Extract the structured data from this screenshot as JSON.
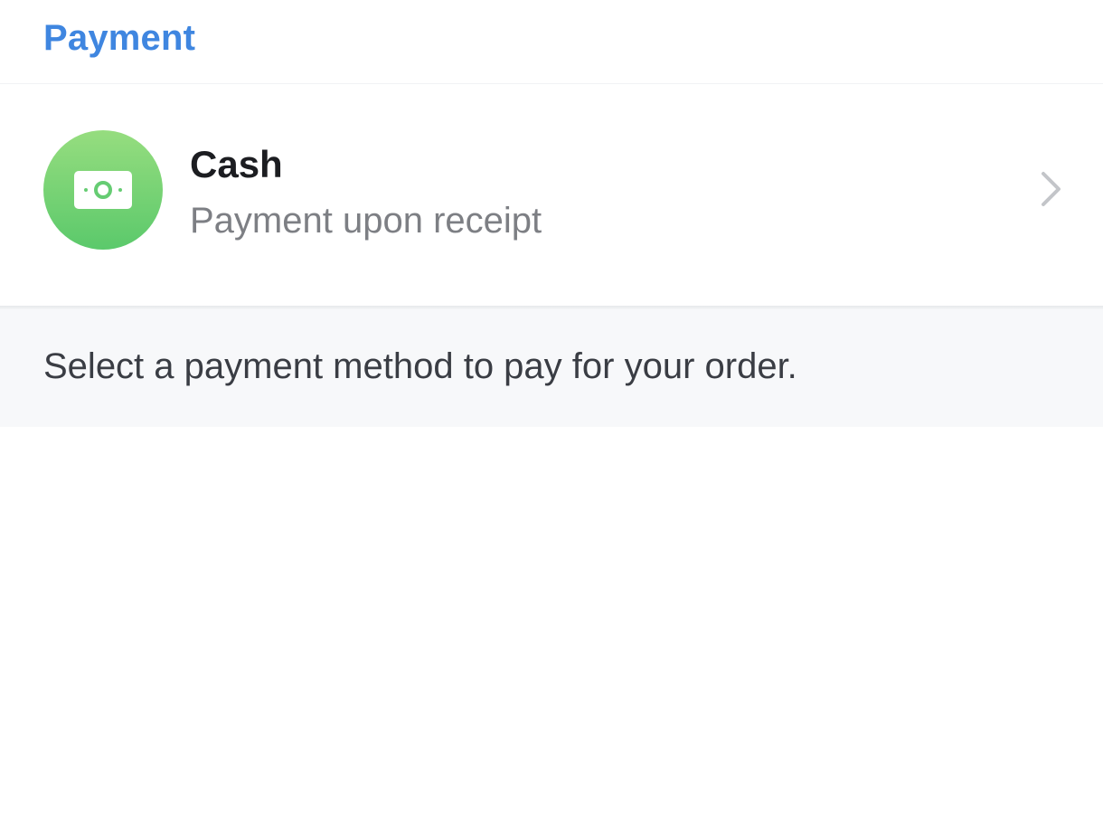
{
  "header": {
    "title": "Payment",
    "title_color": "#3f86e0"
  },
  "payment_method": {
    "icon": "cash-bill-icon",
    "title": "Cash",
    "subtitle": "Payment upon receipt",
    "icon_color": "#5bc96b"
  },
  "hint": {
    "text": "Select a payment method to pay for your order."
  }
}
